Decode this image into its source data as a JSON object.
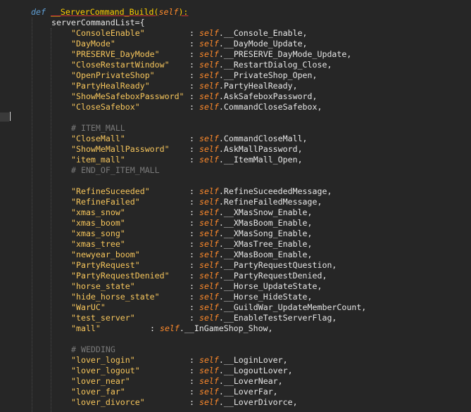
{
  "editor": {
    "def_keyword": "def",
    "function_name": "__ServerCommand_Build",
    "self_param": "self",
    "dict_name": "serverCommandList",
    "assign": "=",
    "open_brace": "{",
    "entries_group1": [
      {
        "key": "\"ConsoleEnable\"",
        "value": ".__Console_Enable,"
      },
      {
        "key": "\"DayMode\"",
        "value": ".__DayMode_Update,"
      },
      {
        "key": "\"PRESERVE_DayMode\"",
        "value": ".__PRESERVE_DayMode_Update,"
      },
      {
        "key": "\"CloseRestartWindow\"",
        "value": ".__RestartDialog_Close,"
      },
      {
        "key": "\"OpenPrivateShop\"",
        "value": ".__PrivateShop_Open,"
      },
      {
        "key": "\"PartyHealReady\"",
        "value": ".PartyHealReady,"
      },
      {
        "key": "\"ShowMeSafeboxPassword\"",
        "value": ".AskSafeboxPassword,"
      },
      {
        "key": "\"CloseSafebox\"",
        "value": ".CommandCloseSafebox,"
      }
    ],
    "comment_item_mall": "# ITEM_MALL",
    "entries_group2": [
      {
        "key": "\"CloseMall\"",
        "value": ".CommandCloseMall,"
      },
      {
        "key": "\"ShowMeMallPassword\"",
        "value": ".AskMallPassword,"
      },
      {
        "key": "\"item_mall\"",
        "value": ".__ItemMall_Open,"
      }
    ],
    "comment_end_item_mall": "# END_OF_ITEM_MALL",
    "entries_group3": [
      {
        "key": "\"RefineSuceeded\"",
        "value": ".RefineSuceededMessage,"
      },
      {
        "key": "\"RefineFailed\"",
        "value": ".RefineFailedMessage,"
      },
      {
        "key": "\"xmas_snow\"",
        "value": ".__XMasSnow_Enable,"
      },
      {
        "key": "\"xmas_boom\"",
        "value": ".__XMasBoom_Enable,"
      },
      {
        "key": "\"xmas_song\"",
        "value": ".__XMasSong_Enable,"
      },
      {
        "key": "\"xmas_tree\"",
        "value": ".__XMasTree_Enable,"
      },
      {
        "key": "\"newyear_boom\"",
        "value": ".__XMasBoom_Enable,"
      },
      {
        "key": "\"PartyRequest\"",
        "value": ".__PartyRequestQuestion,"
      },
      {
        "key": "\"PartyRequestDenied\"",
        "value": ".__PartyRequestDenied,"
      },
      {
        "key": "\"horse_state\"",
        "value": ".__Horse_UpdateState,"
      },
      {
        "key": "\"hide_horse_state\"",
        "value": ".__Horse_HideState,"
      },
      {
        "key": "\"WarUC\"",
        "value": ".__GuildWar_UpdateMemberCount,"
      },
      {
        "key": "\"test_server\"",
        "value": ".__EnableTestServerFlag,"
      }
    ],
    "mall_key": "\"mall\"",
    "mall_value": ".__InGameShop_Show,",
    "comment_wedding": "# WEDDING",
    "entries_group4": [
      {
        "key": "\"lover_login\"",
        "value": ".__LoginLover,"
      },
      {
        "key": "\"lover_logout\"",
        "value": ".__LogoutLover,"
      },
      {
        "key": "\"lover_near\"",
        "value": ".__LoverNear,"
      },
      {
        "key": "\"lover_far\"",
        "value": ".__LoverFar,"
      },
      {
        "key": "\"lover_divorce\"",
        "value": ".__LoverDivorce,"
      }
    ],
    "colon": ":",
    "self_word": "self",
    "colors": {
      "background": "#262626",
      "keyword": "#5f9fd6",
      "function": "#ffcf00",
      "self": "#ff8a2b",
      "string": "#f7c65c",
      "comment": "#7a7a7a",
      "text": "#e6e6e6"
    }
  }
}
